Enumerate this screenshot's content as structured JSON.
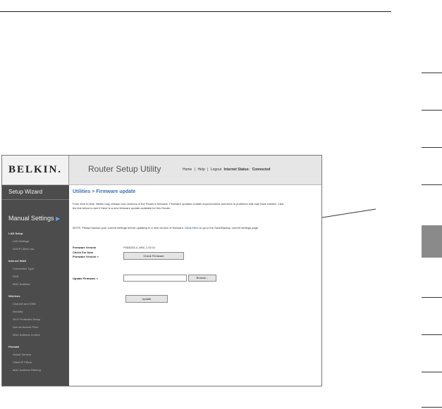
{
  "header": {
    "logo": "BELKIN.",
    "app_title": "Router Setup Utility",
    "links": [
      "Home",
      "|",
      "Help",
      "|",
      "Logout"
    ],
    "status_label": "Internet Status:",
    "status_value": "Connected"
  },
  "sidebar": {
    "setup_wizard": "Setup Wizard",
    "manual_settings": "Manual Settings",
    "arrow": "▶",
    "sections": [
      {
        "title": "LAN Setup",
        "items": [
          "LAN Settings",
          "DHCP Client List"
        ]
      },
      {
        "title": "Internet WAN",
        "items": [
          "Connection Type",
          "DNS",
          "MAC Address"
        ]
      },
      {
        "title": "Wireless",
        "items": [
          "Channel and SSID",
          "Security",
          "Wi-Fi Protected Setup",
          "Use as Access Point",
          "MAC Address Control"
        ]
      },
      {
        "title": "Firewall",
        "items": [
          "Virtual Servers",
          "Client IP Filters",
          "MAC Address Filtering"
        ]
      }
    ]
  },
  "content": {
    "title": "Utilities > Firmware update",
    "intro": "From time to time, Belkin may release new versions of the Router's firmware. Firmware updates contain improvements and fixes to problems that may have existed. Click the link below to see if there is a new firmware update available for this Router.",
    "note_prefix": "NOTE: Please backup your current settings before updating to a new version of firmware.",
    "note_link": "Click Here",
    "note_suffix": "to go to the Save/Backup current settings page.",
    "firmware_version_label": "Firmware Version",
    "firmware_version_value": "F5D8233-4_WW_1.00.01",
    "check_label_line1": "Check For New",
    "check_label_line2": "Firmware Version >",
    "check_button": "Check Firmware",
    "update_label": "Update Firmware >",
    "browse_button": "Browse...",
    "update_button": "Update"
  }
}
